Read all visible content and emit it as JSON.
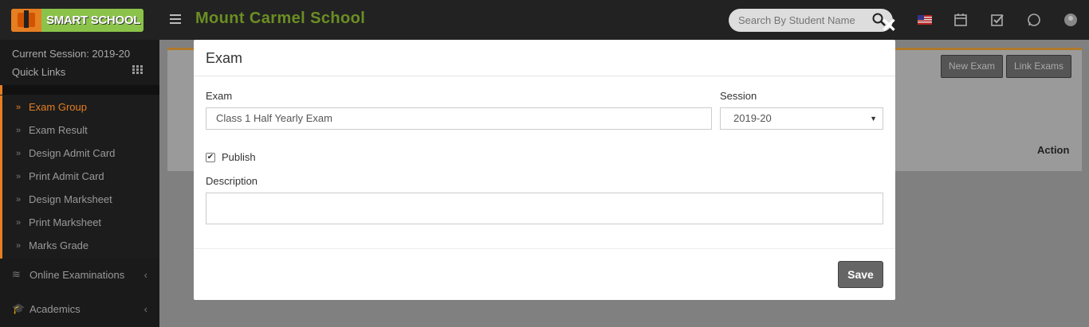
{
  "header": {
    "logo_text": "SMART SCHOOL",
    "school_name": "Mount Carmel School",
    "search_placeholder": "Search By Student Name"
  },
  "sidebar": {
    "session": "Current Session: 2019-20",
    "quick_links": "Quick Links",
    "items": [
      {
        "label": "Exam Group",
        "active": true
      },
      {
        "label": "Exam Result"
      },
      {
        "label": "Design Admit Card"
      },
      {
        "label": "Print Admit Card"
      },
      {
        "label": "Design Marksheet"
      },
      {
        "label": "Print Marksheet"
      },
      {
        "label": "Marks Grade"
      }
    ],
    "sections": [
      {
        "label": "Online Examinations"
      },
      {
        "label": "Academics"
      }
    ]
  },
  "background": {
    "new_exam": "New Exam",
    "link_exams": "Link Exams",
    "action_col": "Action"
  },
  "modal": {
    "title": "Exam",
    "exam_label": "Exam",
    "exam_value": "Class 1  Half Yearly Exam",
    "session_label": "Session",
    "session_value": "2019-20",
    "publish_label": "Publish",
    "publish_checked": true,
    "description_label": "Description",
    "description_value": "",
    "save_label": "Save"
  },
  "colors": {
    "accent": "#e67e22",
    "school_name": "#6b8e23",
    "save_button": "#666666"
  }
}
